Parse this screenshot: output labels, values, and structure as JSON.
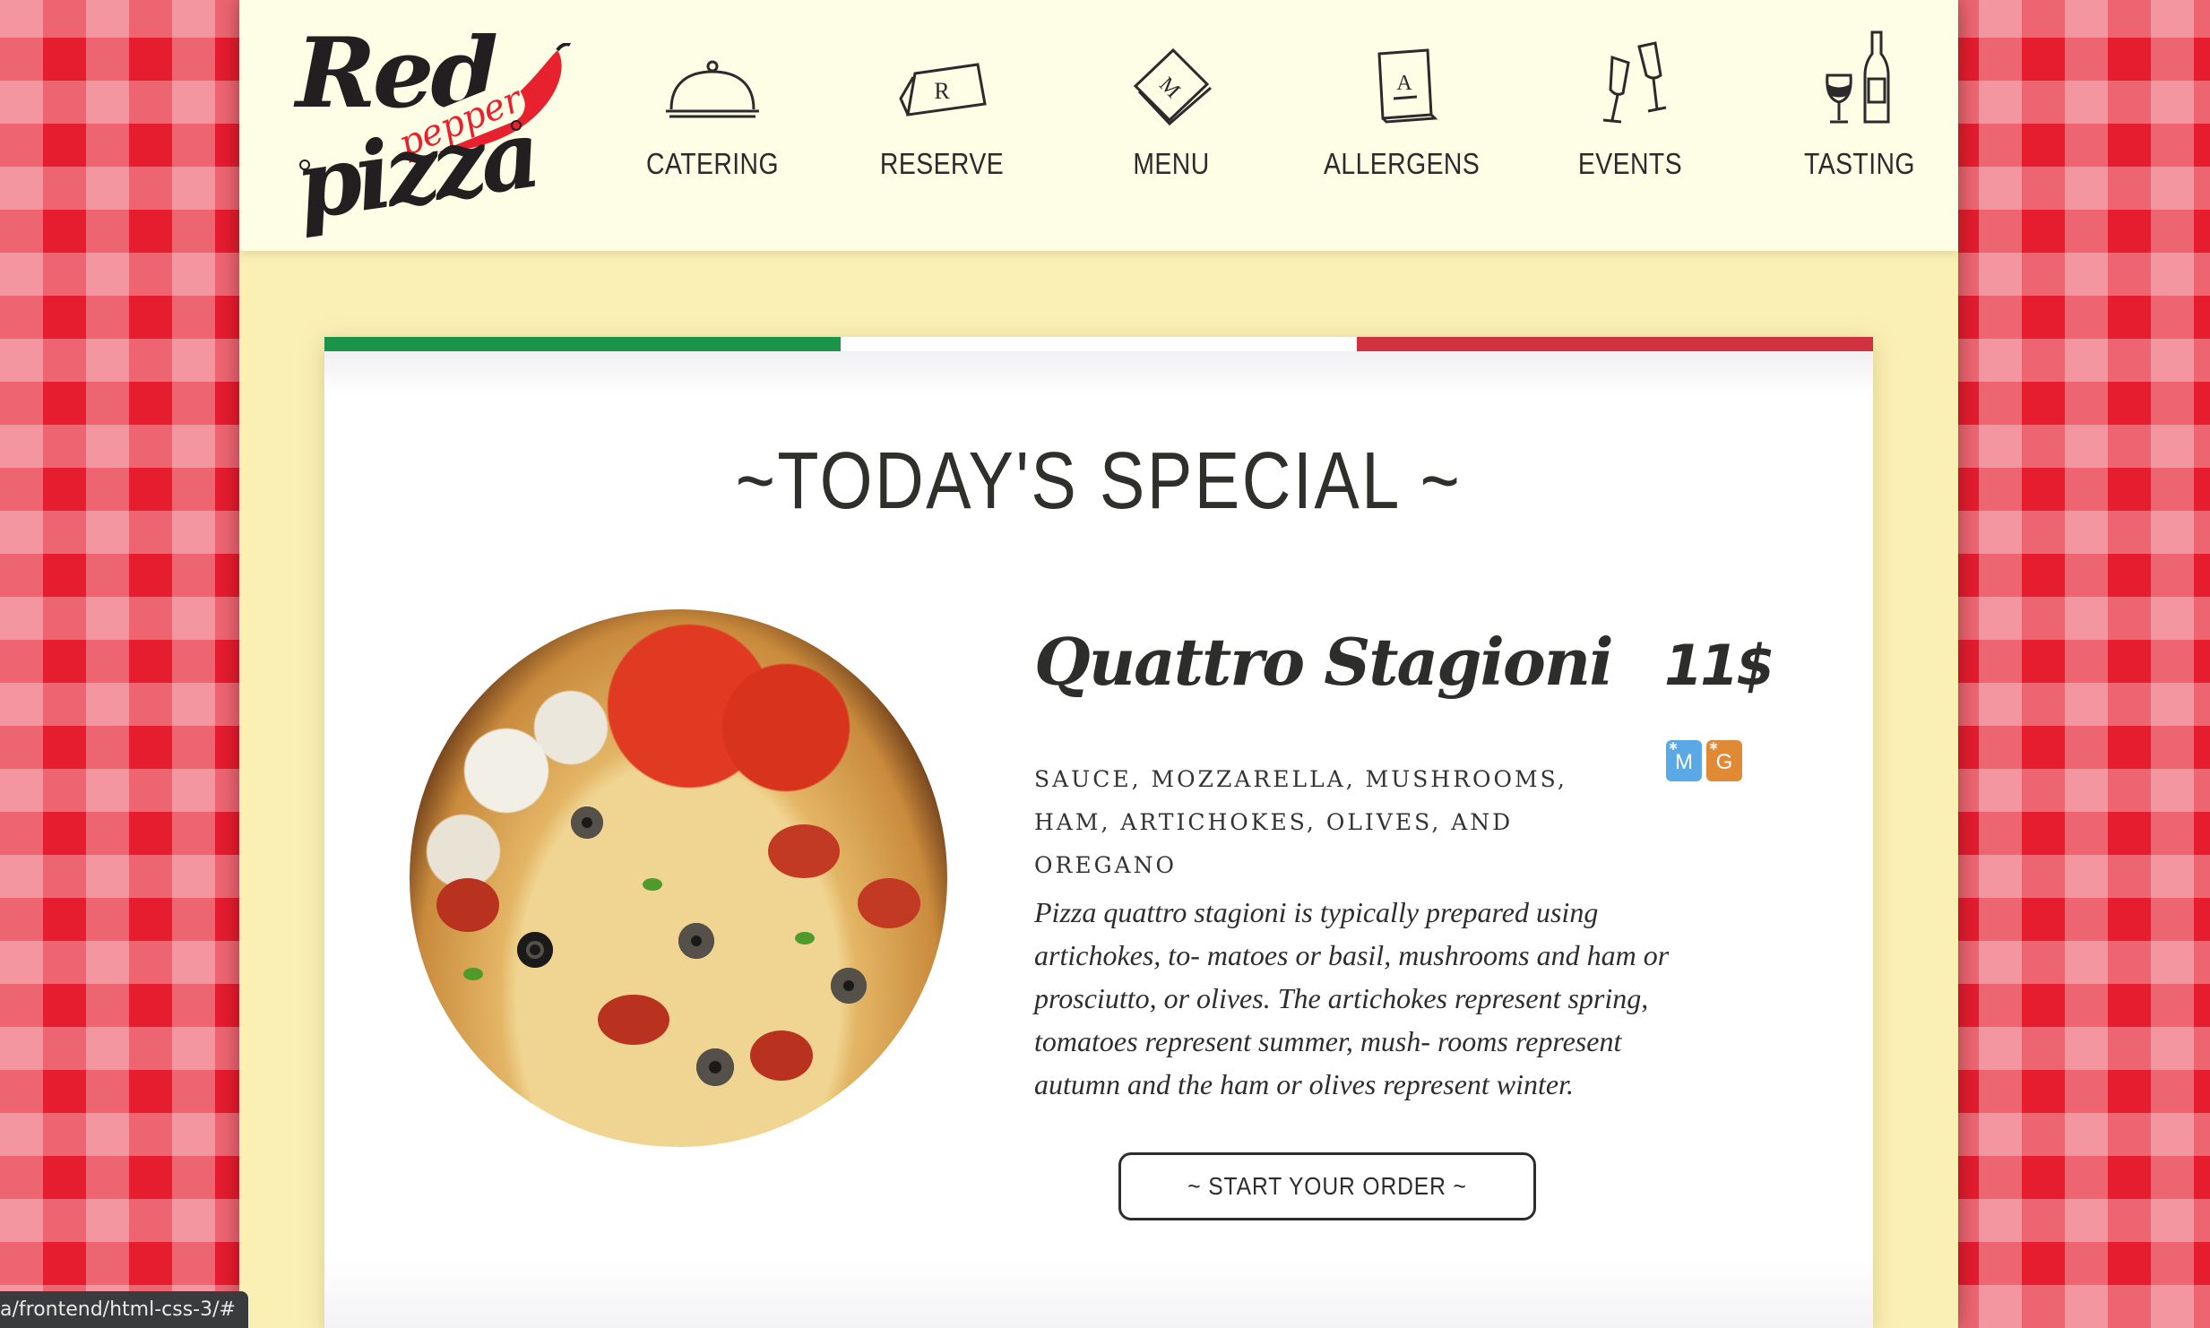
{
  "logo": {
    "word1": "Red",
    "word2": "pepper",
    "word3": "pizza"
  },
  "nav": {
    "items": [
      {
        "label": "CATERING",
        "icon": "cloche-icon"
      },
      {
        "label": "RESERVE",
        "icon": "reserved-card-icon"
      },
      {
        "label": "MENU",
        "icon": "menu-book-icon"
      },
      {
        "label": "ALLERGENS",
        "icon": "allergens-card-icon"
      },
      {
        "label": "EVENTS",
        "icon": "champagne-glasses-icon"
      },
      {
        "label": "TASTING",
        "icon": "wine-bottle-glass-icon"
      }
    ]
  },
  "special": {
    "title": "~TODAY'S SPECIAL ~",
    "dish_name": "Quattro Stagioni",
    "price": "11$",
    "badges": [
      {
        "letter": "M",
        "color": "#5aa9e6"
      },
      {
        "letter": "G",
        "color": "#e08a36"
      }
    ],
    "ingredients": "Sauce, mozzarella, mushrooms, ham, artichokes, olives, and oregano",
    "description": "Pizza quattro stagioni is typically prepared using artichokes, to- matoes or basil, mushrooms and ham or prosciutto, or olives. The artichokes represent spring, tomatoes represent summer, mush- rooms represent autumn and the ham or olives represent winter.",
    "order_button": "~ START YOUR ORDER ~"
  },
  "flag_colors": [
    "#1a9448",
    "#ffffff",
    "#d0323f"
  ],
  "status_bar": {
    "url": "a/frontend/html-css-3/#"
  }
}
